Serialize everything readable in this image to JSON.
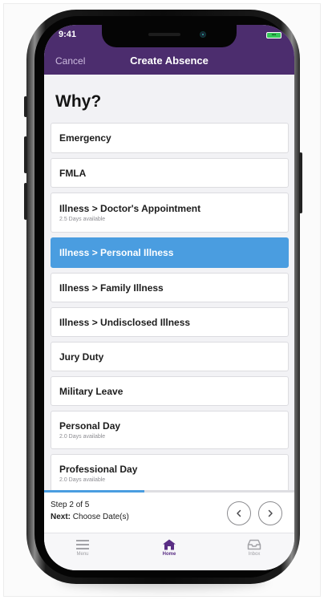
{
  "status_bar": {
    "time": "9:41",
    "battery_label": "•••"
  },
  "nav": {
    "cancel_label": "Cancel",
    "title": "Create Absence"
  },
  "page": {
    "heading": "Why?"
  },
  "reasons": [
    {
      "label": "Emergency",
      "sub": ""
    },
    {
      "label": "FMLA",
      "sub": ""
    },
    {
      "label": "Illness > Doctor's Appointment",
      "sub": "2.5 Days available"
    },
    {
      "label": "Illness > Personal Illness",
      "sub": "",
      "selected": true
    },
    {
      "label": "Illness > Family Illness",
      "sub": ""
    },
    {
      "label": "Illness > Undisclosed Illness",
      "sub": ""
    },
    {
      "label": "Jury Duty",
      "sub": ""
    },
    {
      "label": "Military Leave",
      "sub": ""
    },
    {
      "label": "Personal Day",
      "sub": "2.0 Days available"
    },
    {
      "label": "Professional Day",
      "sub": "2.0 Days available"
    }
  ],
  "progress": {
    "fraction": 0.4
  },
  "step": {
    "count_text": "Step 2 of 5",
    "next_label": "Next:",
    "next_value": "Choose Date(s)"
  },
  "tabs": [
    {
      "label": "Menu",
      "icon": "menu-icon",
      "active": false
    },
    {
      "label": "Home",
      "icon": "home-icon",
      "active": true
    },
    {
      "label": "Inbox",
      "icon": "inbox-icon",
      "active": false
    }
  ],
  "colors": {
    "header": "#4c2d6e",
    "selected": "#4a9de0",
    "active_tab": "#5a2e85",
    "background": "#f2f2f5"
  }
}
